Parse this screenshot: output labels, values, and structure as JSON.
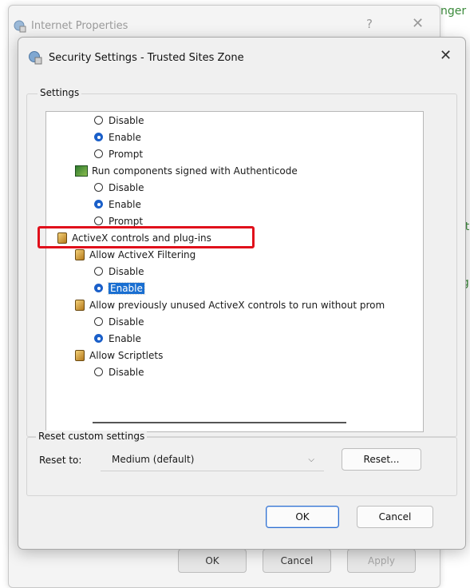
{
  "background": {
    "fragments": [
      "nger",
      "nit",
      "ng",
      ":)"
    ]
  },
  "outer_window": {
    "title": "Internet Properties",
    "help_glyph": "?",
    "close_glyph": "✕",
    "buttons": {
      "ok": "OK",
      "cancel": "Cancel",
      "apply": "Apply"
    }
  },
  "dialog": {
    "title": "Security Settings - Trusted Sites Zone",
    "close_glyph": "✕",
    "settings_group_label": "Settings",
    "items": [
      {
        "type": "radio",
        "label": "Disable",
        "checked": false
      },
      {
        "type": "radio",
        "label": "Enable",
        "checked": true
      },
      {
        "type": "radio",
        "label": "Prompt",
        "checked": false
      },
      {
        "type": "setting",
        "label": "Run components signed with Authenticode"
      },
      {
        "type": "radio",
        "label": "Disable",
        "checked": false
      },
      {
        "type": "radio",
        "label": "Enable",
        "checked": true
      },
      {
        "type": "radio",
        "label": "Prompt",
        "checked": false
      },
      {
        "type": "category",
        "label": "ActiveX controls and plug-ins"
      },
      {
        "type": "setting",
        "label": "Allow ActiveX Filtering"
      },
      {
        "type": "radio",
        "label": "Disable",
        "checked": false
      },
      {
        "type": "radio",
        "label": "Enable",
        "checked": true,
        "selected": true
      },
      {
        "type": "setting",
        "label": "Allow previously unused ActiveX controls to run without prom"
      },
      {
        "type": "radio",
        "label": "Disable",
        "checked": false
      },
      {
        "type": "radio",
        "label": "Enable",
        "checked": true
      },
      {
        "type": "setting",
        "label": "Allow Scriptlets"
      },
      {
        "type": "radio",
        "label": "Disable",
        "checked": false
      }
    ],
    "reset_group_label": "Reset custom settings",
    "reset_to_label": "Reset to:",
    "reset_to_value": "Medium (default)",
    "reset_button": "Reset...",
    "ok_button": "OK",
    "cancel_button": "Cancel"
  },
  "colors": {
    "highlight_box": "#e0101b",
    "selection": "#1a6fd1",
    "radio_on": "#1a5fc9"
  }
}
